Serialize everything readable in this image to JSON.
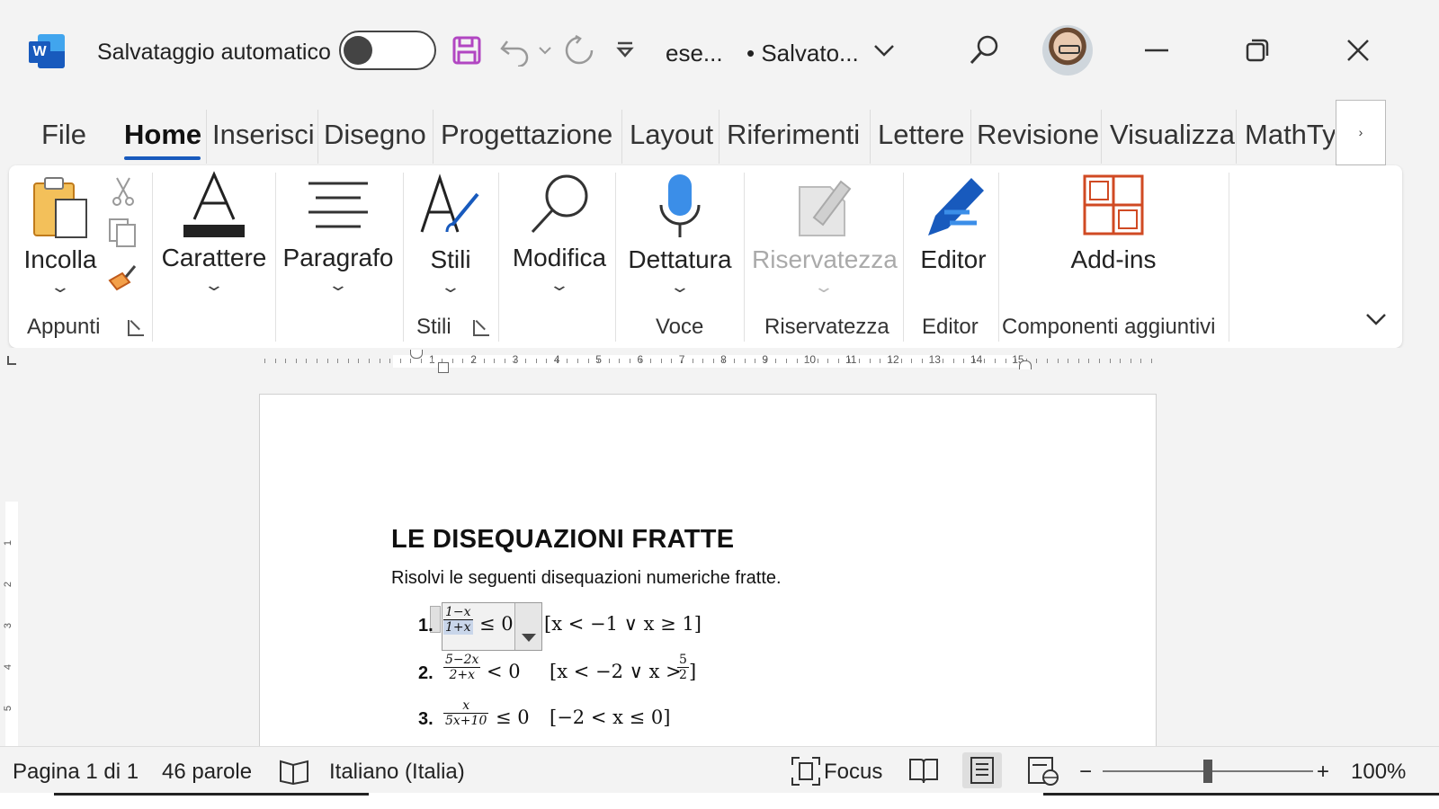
{
  "titlebar": {
    "autosave_label": "Salvataggio automatico",
    "doc_name": "ese...",
    "save_state": "• Salvato...",
    "icons": [
      "word-logo",
      "toggle-off",
      "save-icon",
      "undo-icon",
      "chevron-down-icon",
      "redo-icon",
      "customize-qat-icon",
      "search-icon",
      "avatar",
      "minimize-icon",
      "restore-icon",
      "close-icon"
    ]
  },
  "tabs": [
    "File",
    "Home",
    "Inserisci",
    "Disegno",
    "Progettazione",
    "Layout",
    "Riferimenti",
    "Lettere",
    "Revisione",
    "Visualizza",
    "MathTy"
  ],
  "tab_more_label": "›",
  "ribbon": {
    "paste": "Incolla",
    "font": "Carattere",
    "paragraph": "Paragrafo",
    "styles": "Stili",
    "edit": "Modifica",
    "dictate": "Dettatura",
    "sensitivity": "Riservatezza",
    "editor": "Editor",
    "addins": "Add-ins",
    "groups": {
      "clipboard": "Appunti",
      "styles": "Stili",
      "voice": "Voce",
      "sensitivity": "Riservatezza",
      "editor": "Editor",
      "addins": "Componenti aggiuntivi"
    }
  },
  "ruler": [
    "1",
    "2",
    "3",
    "4",
    "5",
    "6",
    "7",
    "8",
    "9",
    "10",
    "11",
    "12",
    "13",
    "14",
    "15"
  ],
  "vruler": [
    "1",
    "2",
    "3",
    "4",
    "5"
  ],
  "document": {
    "title": "LE DISEQUAZIONI FRATTE",
    "subtitle": "Risolvi le seguenti disequazioni numeriche fratte.",
    "items": [
      {
        "num": "1.",
        "numerator": "1−x",
        "denominator": "1+x",
        "relation": "≤ 0",
        "solution": "[x < −1 ∨ x ≥ 1]"
      },
      {
        "num": "2.",
        "numerator": "5−2x",
        "denominator": "2+x",
        "relation": "< 0",
        "solution": "[x < −2 ∨ x >",
        "sol_frac_num": "5",
        "sol_frac_den": "2",
        "sol_close": "]"
      },
      {
        "num": "3.",
        "numerator": "x",
        "denominator": "5x+10",
        "relation": "≤ 0",
        "solution": "[−2 < x ≤ 0]"
      }
    ]
  },
  "statusbar": {
    "page": "Pagina 1 di 1",
    "words": "46 parole",
    "language": "Italiano (Italia)",
    "focus": "Focus",
    "zoom_minus": "−",
    "zoom_plus": "+",
    "zoom": "100%",
    "zoom_level": 1.0
  },
  "colors": {
    "word_blue": "#185abd",
    "accent_light": "#41a5ee",
    "save_icon": "#b146c2",
    "addins_icon": "#d04a23"
  }
}
